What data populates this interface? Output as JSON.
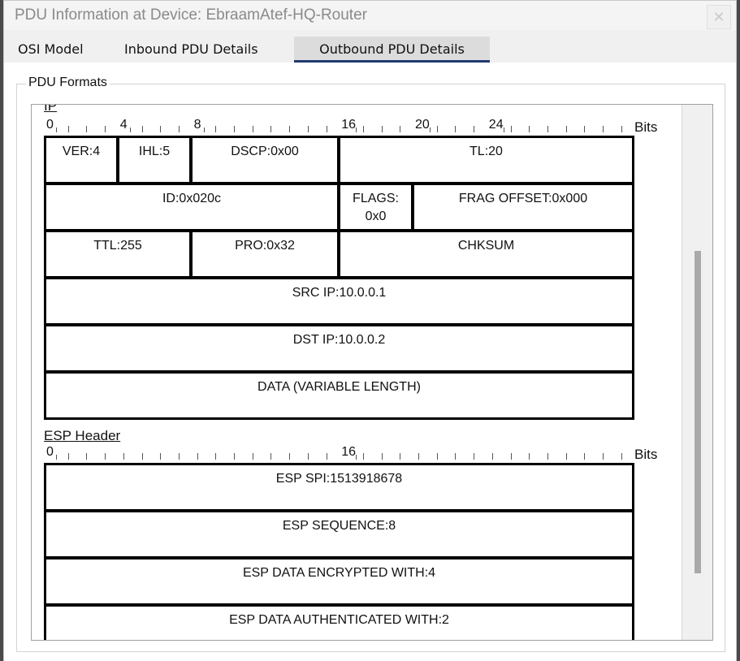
{
  "window": {
    "title": "PDU Information at Device: EbraamAtef-HQ-Router",
    "close_glyph": "✕"
  },
  "tabs": [
    {
      "label": "OSI Model"
    },
    {
      "label": "Inbound PDU Details"
    },
    {
      "label": "Outbound PDU Details"
    }
  ],
  "group": {
    "label": "PDU Formats"
  },
  "bits_label": "Bits",
  "ip": {
    "title": "IP",
    "ruler_labels": [
      "0",
      "4",
      "8",
      "16",
      "20",
      "24"
    ],
    "fields": {
      "ver": "VER:4",
      "ihl": "IHL:5",
      "dscp": "DSCP:0x00",
      "tl": "TL:20",
      "id": "ID:0x020c",
      "flags": "FLAGS:\n0x0",
      "frag": "FRAG OFFSET:0x000",
      "ttl": "TTL:255",
      "pro": "PRO:0x32",
      "chksum": "CHKSUM",
      "src": "SRC IP:10.0.0.1",
      "dst": "DST IP:10.0.0.2",
      "data": "DATA (VARIABLE LENGTH)"
    }
  },
  "esp": {
    "title": "ESP Header",
    "ruler_labels": [
      "0",
      "16"
    ],
    "fields": {
      "spi": "ESP SPI:1513918678",
      "seq": "ESP SEQUENCE:8",
      "enc": "ESP DATA ENCRYPTED WITH:4",
      "auth": "ESP DATA AUTHENTICATED WITH:2"
    }
  }
}
